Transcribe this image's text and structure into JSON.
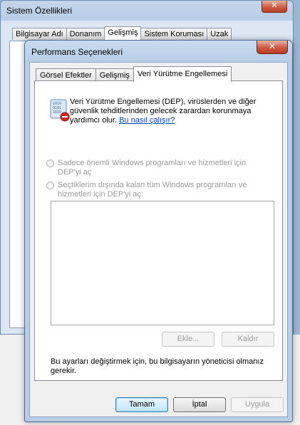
{
  "background_window": {
    "title": "Sistem Özellikleri",
    "close_label": "✕",
    "tabs": [
      {
        "label": "Bilgisayar Adı"
      },
      {
        "label": "Donanım"
      },
      {
        "label": "Gelişmiş"
      },
      {
        "label": "Sistem Koruması"
      },
      {
        "label": "Uzak"
      }
    ],
    "active_tab": "Gelişmiş"
  },
  "dialog": {
    "title": "Performans Seçenekleri",
    "close_label": "✕",
    "tabs": [
      {
        "label": "Görsel Efektler"
      },
      {
        "label": "Gelişmiş"
      },
      {
        "label": "Veri Yürütme Engellemesi"
      }
    ],
    "active_tab": "Veri Yürütme Engellemesi",
    "description": "Veri Yürütme Engellemesi (DEP), virüslerden ve diğer güvenlik tehditlerinden gelecek zarardan korunmaya yardımcı olur.",
    "help_link": "Bu nasıl çalışır?",
    "option_essential": "Sadece önemli Windows programları ve hizmetleri için DEP'yi aç",
    "option_all_except": "Seçtiklerim dışında kalan tüm Windows programları ve hizmetleri için DEP'yi aç:",
    "add_button": "Ekle...",
    "remove_button": "Kaldır",
    "admin_note": "Bu ayarları değiştirmek için, bu bilgisayarın yöneticisi olmanız gerekir.",
    "ok_button": "Tamam",
    "cancel_button": "İptal",
    "apply_button": "Uygula"
  },
  "colors": {
    "link": "#0645ad",
    "disabled_text": "#9a9a9a",
    "title_bar": "#b8cee8",
    "close_button": "#cf5a3f"
  },
  "icons": {
    "dep": "dep-shield-binary-icon"
  }
}
